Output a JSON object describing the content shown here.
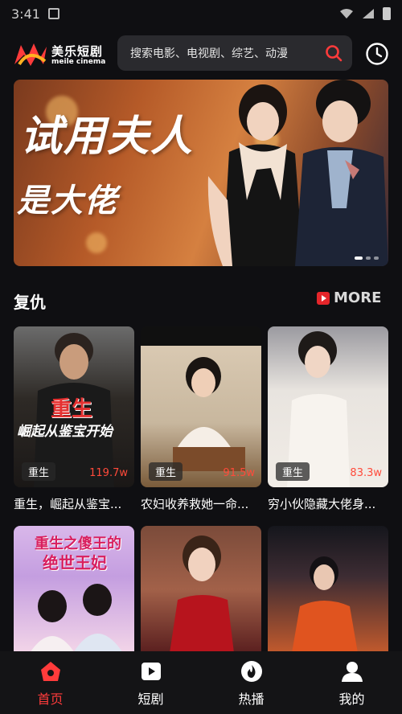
{
  "status_bar": {
    "time": "3:41"
  },
  "header": {
    "brand_cn": "美乐短剧",
    "brand_en": "meile cinema",
    "search_placeholder": "搜索电影、电视剧、综艺、动漫"
  },
  "banner": {
    "title_line1": "试用夫人",
    "title_line2": "是大佬",
    "slide_count": 3,
    "active_slide": 1
  },
  "section": {
    "title": "复仇",
    "more_label": "MORE"
  },
  "cards": [
    {
      "tag": "重生",
      "views": "119.7w",
      "title": "重生，崛起从鉴宝..."
    },
    {
      "tag": "重生",
      "views": "91.5w",
      "title": "农妇收养救她一命..."
    },
    {
      "tag": "重生",
      "views": "83.3w",
      "title": "穷小伙隐藏大佬身..."
    },
    {
      "tag": "",
      "views": "",
      "title": ""
    },
    {
      "tag": "",
      "views": "",
      "title": ""
    },
    {
      "tag": "",
      "views": "",
      "title": ""
    }
  ],
  "poster_text": {
    "card1": "重生",
    "card1_sub": "崛起从鉴宝开始",
    "card4_line1": "重生之傻王的",
    "card4_line2": "绝世王妃"
  },
  "bottom_nav": [
    {
      "label": "首页",
      "active": true
    },
    {
      "label": "短剧",
      "active": false
    },
    {
      "label": "热播",
      "active": false
    },
    {
      "label": "我的",
      "active": false
    }
  ],
  "colors": {
    "accent": "#ff3b3b",
    "background": "#0f0f12",
    "search_bg": "#2a2a2e"
  }
}
